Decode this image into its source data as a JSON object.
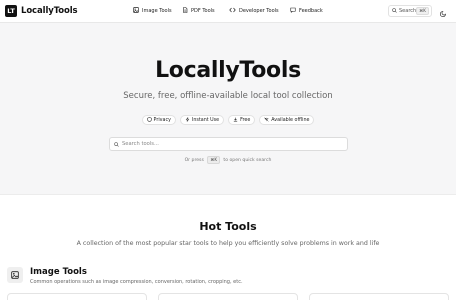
{
  "header": {
    "logo_mark": "LT",
    "app_name": "LocallyTools",
    "nav": [
      {
        "label": "Image Tools",
        "icon": "image-icon"
      },
      {
        "label": "PDF Tools",
        "icon": "document-icon"
      },
      {
        "label": "Developer Tools",
        "icon": "code-icon"
      },
      {
        "label": "Feedback",
        "icon": "message-icon"
      }
    ],
    "search_label": "Search",
    "search_shortcut": "⌘K",
    "theme_icon": "moon-icon"
  },
  "hero": {
    "title": "LocallyTools",
    "subtitle": "Secure, free, offline-available local tool collection",
    "badges": [
      {
        "label": "Privacy",
        "icon": "shield-icon"
      },
      {
        "label": "Instant Use",
        "icon": "bolt-icon"
      },
      {
        "label": "Free",
        "icon": "download-icon"
      },
      {
        "label": "Available offline",
        "icon": "wifi-off-icon"
      }
    ],
    "search_placeholder": "Search tools...",
    "hint_prefix": "Or press",
    "hint_key": "⌘K",
    "hint_suffix": "to open quick search"
  },
  "hot": {
    "title": "Hot Tools",
    "description": "A collection of the most popular star tools to help you efficiently solve problems in work and life"
  },
  "category": {
    "icon": "image-icon",
    "title": "Image Tools",
    "description": "Common operations such as image compression, conversion, rotation, cropping, etc."
  },
  "colors": {
    "hero_bg": "#f6f6f7",
    "text_primary": "#111111",
    "text_muted": "#666666",
    "border": "#e2e2e2"
  }
}
